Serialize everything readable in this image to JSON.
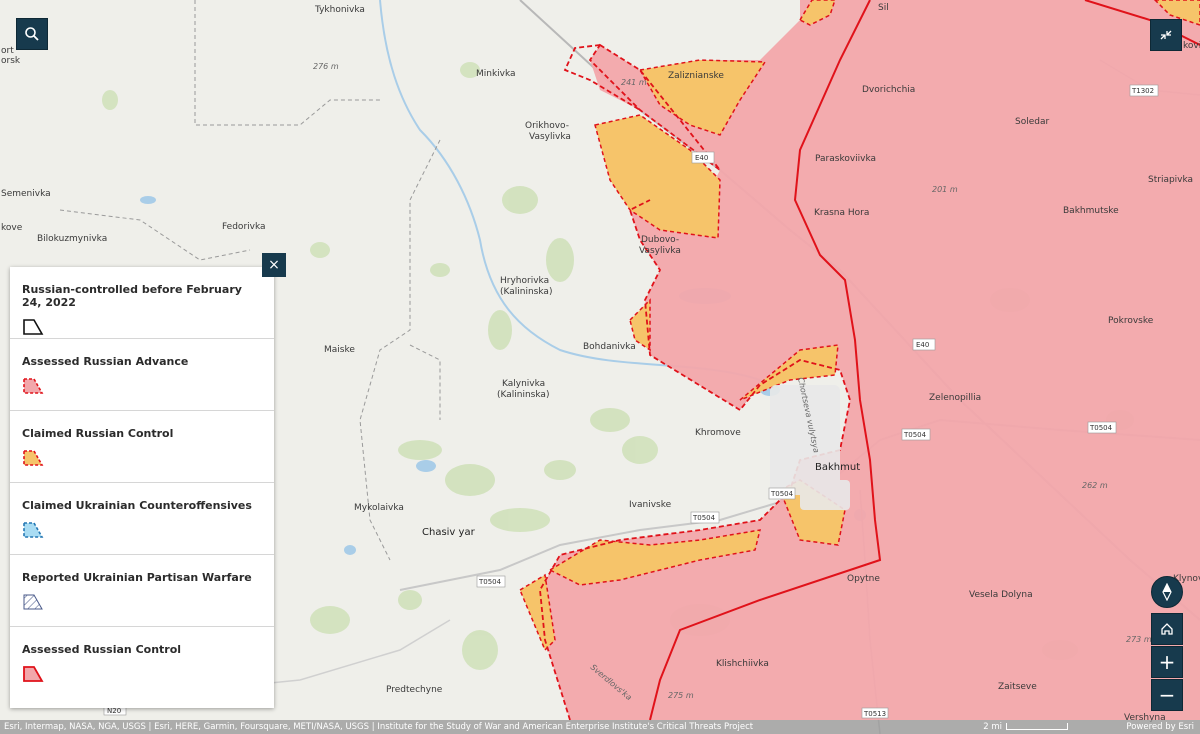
{
  "legend": {
    "close_label": "×",
    "items": [
      {
        "label": "Russian-controlled before February 24, 2022",
        "symbol": "black-outline"
      },
      {
        "label": "Assessed Russian Advance",
        "symbol": "red-dashed-fill"
      },
      {
        "label": "Claimed Russian Control",
        "symbol": "orange-dashed-fill"
      },
      {
        "label": "Claimed Ukrainian Counteroffensives",
        "symbol": "blue-dashed-fill"
      },
      {
        "label": "Reported Ukrainian Partisan Warfare",
        "symbol": "hatched"
      },
      {
        "label": "Assessed Russian Control",
        "symbol": "red-solid-fill"
      }
    ]
  },
  "colors": {
    "russian_control": "#f2a7ab",
    "russian_border": "#e0121a",
    "claimed_russian": "#f6c46a",
    "ukraine_cf": "#a9dcf3",
    "button_bg": "#173a4d",
    "map_bg": "#efefea"
  },
  "controls": {
    "search": "search-icon",
    "collapse": "collapse-icon",
    "compass": "compass-icon",
    "home": "home-icon",
    "zoom_in": "+",
    "zoom_out": "−"
  },
  "places": {
    "tykhonivka": "Tykhonivka",
    "sil": "Sil",
    "minkivka": "Minkivka",
    "zaliznianske": "Zaliznianske",
    "dvorichchia": "Dvorichchia",
    "soledar": "Soledar",
    "orikhovo1": "Orikhovo-",
    "orikhovo2": "Vasylivka",
    "paraskoviivka": "Paraskoviivka",
    "striapivka": "Striapivka",
    "semenivka": "Semenivka",
    "fedorivka": "Fedorivka",
    "krasna_hora": "Krasna Hora",
    "bakhmutske": "Bakhmutske",
    "bilokuzmynivka": "Bilokuzmynivka",
    "dubovo1": "Dubovo-",
    "dubovo2": "Vasylivka",
    "hryhorivka1": "Hryhorivka",
    "hryhorivka2": "(Kalininska)",
    "pokrovske": "Pokrovske",
    "maiske": "Maiske",
    "bohdanivka": "Bohdanivka",
    "kalynivka1": "Kalynivka",
    "kalynivka2": "(Kalininska)",
    "zelenopillia": "Zelenopillia",
    "khromove": "Khromove",
    "bakhmut": "Bakhmut",
    "mykolaivka": "Mykolaivka",
    "ivanivske": "Ivanivske",
    "chasiv_yar": "Chasiv yar",
    "opytne": "Opytne",
    "vesela_dolyna": "Vesela Dolyna",
    "klyn": "Klynov",
    "klishchiivka": "Klishchiivka",
    "predtechyne": "Predtechyne",
    "zaitseve": "Zaitseve",
    "vershyna": "Vershyna",
    "korsk": "orsk",
    "port": "ort",
    "kove": "kove",
    "kovi": "kovi",
    "street": "Chortseva vulytsya",
    "street2": "Sverdlovs'ka",
    "elev_276": "276 m",
    "elev_241": "241 m",
    "elev_201": "201 m",
    "elev_262": "262 m",
    "elev_273": "273 m",
    "elev_275": "275 m",
    "road_e40a": "E40",
    "road_e40b": "E40",
    "road_t1302": "T1302",
    "road_t0504a": "T0504",
    "road_t0504b": "T0504",
    "road_t0504c": "T0504",
    "road_t0504d": "T0504",
    "road_t0504e": "T0504",
    "road_t0513": "T0513",
    "road_n20": "N20"
  },
  "attribution": {
    "text": "Esri, Intermap, NASA, NGA, USGS | Esri, HERE, Garmin, Foursquare, METI/NASA, USGS | Institute for the Study of War and American Enterprise Institute's Critical Threats Project",
    "scale": "2 mi",
    "powered": "Powered by Esri"
  }
}
